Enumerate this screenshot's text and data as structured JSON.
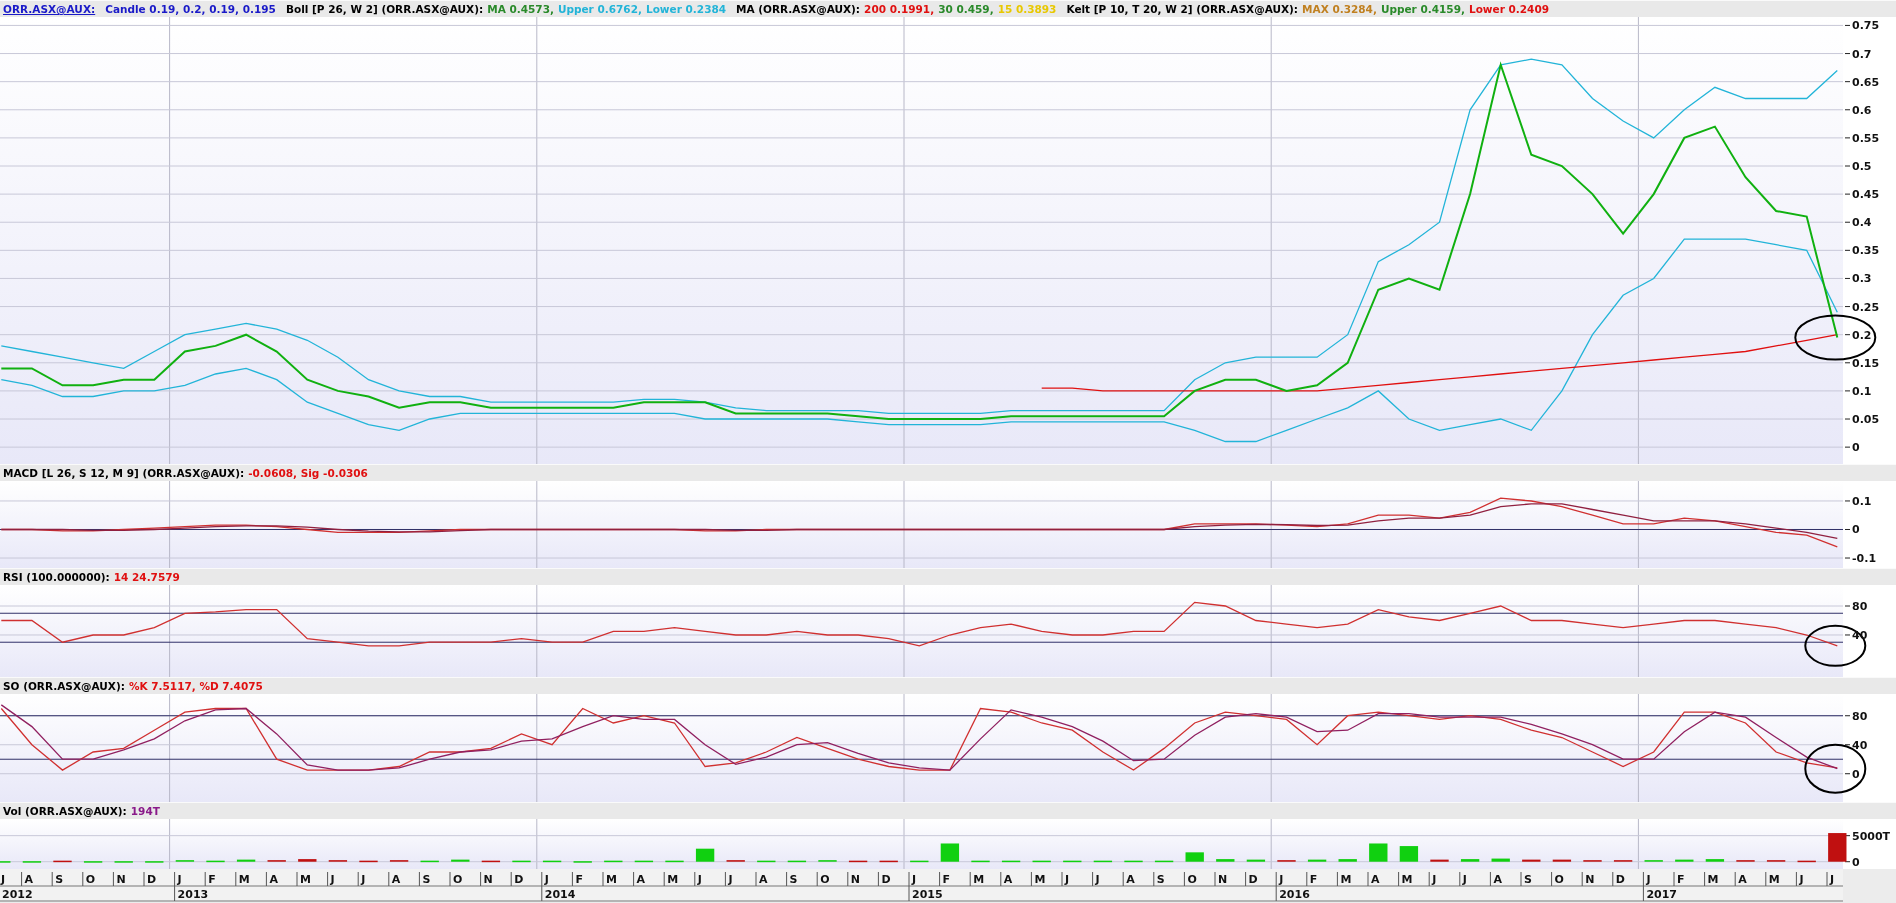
{
  "panels": [
    {
      "kind": "price",
      "legend": [
        {
          "text": "ORR.ASX@AUX:",
          "color": "#1a1ac8",
          "kind": "link"
        },
        {
          "text": "Candle 0.19, 0.2, 0.19, 0.195",
          "color": "#1a1ac8"
        },
        {
          "text": "Boll [P 26, W 2] (ORR.ASX@AUX):",
          "color": "#000000"
        },
        {
          "text": "MA 0.4573,",
          "color": "#2a8a2a"
        },
        {
          "text": "Upper 0.6762,",
          "color": "#22b4d8"
        },
        {
          "text": "Lower 0.2384",
          "color": "#22b4d8"
        },
        {
          "text": "MA (ORR.ASX@AUX):",
          "color": "#000000"
        },
        {
          "text": "200 0.1991,",
          "color": "#e01010"
        },
        {
          "text": "30 0.459,",
          "color": "#2a8a2a"
        },
        {
          "text": "15 0.3893",
          "color": "#e8c800"
        },
        {
          "text": "Kelt [P 10, T 20, W 2] (ORR.ASX@AUX):",
          "color": "#000000"
        },
        {
          "text": "MAX 0.3284,",
          "color": "#c08020"
        },
        {
          "text": "Upper 0.4159,",
          "color": "#2a8a2a"
        },
        {
          "text": "Lower 0.2409",
          "color": "#e01010"
        }
      ],
      "chart_data": {
        "type": "line",
        "ylim": [
          -0.03,
          0.765
        ],
        "yticks": [
          0,
          0.05,
          0.1,
          0.15,
          0.2,
          0.25,
          0.3,
          0.35,
          0.4,
          0.45,
          0.5,
          0.55,
          0.6,
          0.65,
          0.7,
          0.75
        ],
        "series": [
          {
            "color": "#22b4d8",
            "values": [
              0.18,
              0.17,
              0.16,
              0.15,
              0.14,
              0.17,
              0.2,
              0.21,
              0.22,
              0.21,
              0.19,
              0.16,
              0.12,
              0.1,
              0.09,
              0.09,
              0.08,
              0.08,
              0.08,
              0.08,
              0.08,
              0.085,
              0.085,
              0.08,
              0.07,
              0.065,
              0.065,
              0.065,
              0.065,
              0.06,
              0.06,
              0.06,
              0.06,
              0.065,
              0.065,
              0.065,
              0.065,
              0.065,
              0.065,
              0.12,
              0.15,
              0.16,
              0.16,
              0.16,
              0.2,
              0.33,
              0.36,
              0.4,
              0.6,
              0.68,
              0.69,
              0.68,
              0.62,
              0.58,
              0.55,
              0.6,
              0.64,
              0.62,
              0.62,
              0.62,
              0.67
            ]
          },
          {
            "color": "#22b4d8",
            "values": [
              0.12,
              0.11,
              0.09,
              0.09,
              0.1,
              0.1,
              0.11,
              0.13,
              0.14,
              0.12,
              0.08,
              0.06,
              0.04,
              0.03,
              0.05,
              0.06,
              0.06,
              0.06,
              0.06,
              0.06,
              0.06,
              0.06,
              0.06,
              0.05,
              0.05,
              0.05,
              0.05,
              0.05,
              0.045,
              0.04,
              0.04,
              0.04,
              0.04,
              0.045,
              0.045,
              0.045,
              0.045,
              0.045,
              0.045,
              0.03,
              0.01,
              0.01,
              0.03,
              0.05,
              0.07,
              0.1,
              0.05,
              0.03,
              0.04,
              0.05,
              0.03,
              0.1,
              0.2,
              0.27,
              0.3,
              0.37,
              0.37,
              0.37,
              0.36,
              0.35,
              0.24
            ]
          },
          {
            "color": "#e01010",
            "values": [
              null,
              null,
              null,
              null,
              null,
              null,
              null,
              null,
              null,
              null,
              null,
              null,
              null,
              null,
              null,
              null,
              null,
              null,
              null,
              null,
              null,
              null,
              null,
              null,
              null,
              null,
              null,
              null,
              null,
              null,
              null,
              null,
              null,
              null,
              0.105,
              0.105,
              0.1,
              0.1,
              0.1,
              0.1,
              0.1,
              0.1,
              0.1,
              0.1,
              0.105,
              0.11,
              0.115,
              0.12,
              0.125,
              0.13,
              0.135,
              0.14,
              0.145,
              0.15,
              0.155,
              0.16,
              0.165,
              0.17,
              0.18,
              0.19,
              0.2
            ]
          },
          {
            "color": "#10b010",
            "values": [
              0.14,
              0.14,
              0.11,
              0.11,
              0.12,
              0.12,
              0.17,
              0.18,
              0.2,
              0.17,
              0.12,
              0.1,
              0.09,
              0.07,
              0.08,
              0.08,
              0.07,
              0.07,
              0.07,
              0.07,
              0.07,
              0.08,
              0.08,
              0.08,
              0.06,
              0.06,
              0.06,
              0.06,
              0.055,
              0.05,
              0.05,
              0.05,
              0.05,
              0.055,
              0.055,
              0.055,
              0.055,
              0.055,
              0.055,
              0.1,
              0.12,
              0.12,
              0.1,
              0.11,
              0.15,
              0.28,
              0.3,
              0.28,
              0.45,
              0.68,
              0.52,
              0.5,
              0.45,
              0.38,
              0.45,
              0.55,
              0.57,
              0.48,
              0.42,
              0.41,
              0.195
            ]
          }
        ],
        "grid": true
      },
      "highlight_last": true
    },
    {
      "kind": "macd",
      "legend": [
        {
          "text": "MACD [L 26, S 12, M 9] (ORR.ASX@AUX):",
          "color": "#000000"
        },
        {
          "text": "-0.0608, Sig -0.0306",
          "color": "#e01010"
        }
      ],
      "chart_data": {
        "type": "line",
        "ylim": [
          -0.135,
          0.17
        ],
        "yticks": [
          -0.1,
          0,
          0.1
        ],
        "series": [
          {
            "color": "#d03030",
            "values": [
              0,
              0,
              -0.005,
              -0.005,
              0,
              0.005,
              0.01,
              0.015,
              0.015,
              0.01,
              0,
              -0.01,
              -0.01,
              -0.01,
              -0.005,
              0,
              0,
              0,
              0,
              0,
              0,
              0,
              0,
              -0.005,
              -0.005,
              0,
              0,
              0,
              0,
              0,
              0,
              0,
              0,
              0,
              0,
              0,
              0,
              0,
              0,
              0.02,
              0.02,
              0.02,
              0.015,
              0.01,
              0.02,
              0.05,
              0.05,
              0.04,
              0.06,
              0.11,
              0.1,
              0.08,
              0.05,
              0.02,
              0.02,
              0.04,
              0.03,
              0.01,
              -0.01,
              -0.02,
              -0.061
            ]
          },
          {
            "color": "#902040",
            "values": [
              0,
              0,
              0,
              -0.003,
              -0.003,
              0,
              0.005,
              0.01,
              0.013,
              0.013,
              0.008,
              0,
              -0.006,
              -0.008,
              -0.008,
              -0.004,
              0,
              0,
              0,
              0,
              0,
              0,
              0,
              0,
              -0.003,
              -0.003,
              0,
              0,
              0,
              0,
              0,
              0,
              0,
              0,
              0,
              0,
              0,
              0,
              0,
              0.01,
              0.015,
              0.018,
              0.017,
              0.014,
              0.015,
              0.03,
              0.04,
              0.04,
              0.05,
              0.08,
              0.09,
              0.09,
              0.07,
              0.05,
              0.03,
              0.03,
              0.03,
              0.02,
              0.005,
              -0.01,
              -0.031
            ]
          }
        ],
        "grid": true,
        "ref_lines": [
          {
            "axis": "y",
            "value": 0
          }
        ]
      }
    },
    {
      "kind": "rsi",
      "legend": [
        {
          "text": "RSI (100.000000):",
          "color": "#000000"
        },
        {
          "text": "14 24.7579",
          "color": "#e01010"
        }
      ],
      "chart_data": {
        "type": "line",
        "ylim": [
          -18,
          109
        ],
        "yticks": [
          40,
          80
        ],
        "series": [
          {
            "color": "#d03030",
            "values": [
              60,
              60,
              30,
              40,
              40,
              50,
              70,
              72,
              75,
              75,
              35,
              30,
              25,
              25,
              30,
              30,
              30,
              35,
              30,
              30,
              45,
              45,
              50,
              45,
              40,
              40,
              45,
              40,
              40,
              35,
              25,
              40,
              50,
              55,
              45,
              40,
              40,
              45,
              45,
              85,
              80,
              60,
              55,
              50,
              55,
              75,
              65,
              60,
              70,
              80,
              60,
              60,
              55,
              50,
              55,
              60,
              60,
              55,
              50,
              40,
              25
            ]
          }
        ],
        "grid": true,
        "ref_lines": [
          {
            "axis": "y",
            "value": 70
          },
          {
            "axis": "y",
            "value": 30
          }
        ]
      },
      "highlight_last": true
    },
    {
      "kind": "so",
      "legend": [
        {
          "text": "SO (ORR.ASX@AUX):",
          "color": "#000000"
        },
        {
          "text": "%K 7.5117, %D 7.4075",
          "color": "#e01010"
        }
      ],
      "chart_data": {
        "type": "line",
        "ylim": [
          -39,
          110
        ],
        "yticks": [
          0,
          40,
          80
        ],
        "series": [
          {
            "color": "#d03030",
            "values": [
              90,
              40,
              5,
              30,
              35,
              60,
              85,
              90,
              90,
              20,
              5,
              5,
              5,
              10,
              30,
              30,
              35,
              55,
              40,
              90,
              70,
              80,
              70,
              10,
              15,
              30,
              50,
              35,
              20,
              10,
              5,
              5,
              90,
              85,
              70,
              60,
              30,
              5,
              35,
              70,
              85,
              80,
              75,
              40,
              80,
              85,
              80,
              75,
              80,
              75,
              60,
              50,
              30,
              10,
              30,
              85,
              85,
              70,
              30,
              15,
              8
            ]
          },
          {
            "color": "#902060",
            "values": [
              95,
              65,
              20,
              20,
              33,
              48,
              73,
              88,
              90,
              55,
              12,
              5,
              5,
              8,
              20,
              30,
              33,
              45,
              48,
              65,
              80,
              75,
              75,
              40,
              13,
              23,
              40,
              43,
              28,
              15,
              8,
              5,
              48,
              88,
              78,
              65,
              45,
              18,
              20,
              53,
              78,
              83,
              78,
              58,
              60,
              83,
              83,
              78,
              78,
              78,
              68,
              55,
              40,
              20,
              20,
              58,
              85,
              78,
              50,
              23,
              7
            ]
          }
        ],
        "grid": true,
        "ref_lines": [
          {
            "axis": "y",
            "value": 80
          },
          {
            "axis": "y",
            "value": 20
          }
        ]
      },
      "highlight_last": true
    },
    {
      "kind": "volume",
      "legend": [
        {
          "text": "Vol (ORR.ASX@AUX):",
          "color": "#000000"
        },
        {
          "text": "194T",
          "color": "#8a1a8a"
        }
      ],
      "chart_data": {
        "type": "bar",
        "ylim": [
          -1400,
          8200
        ],
        "yticks": [
          0,
          {
            "value": 5000,
            "label": "5000T"
          }
        ],
        "series": [
          {
            "color": "#10d010",
            "values": [
              100,
              100,
              null,
              100,
              100,
              100,
              300,
              200,
              400,
              null,
              null,
              null,
              null,
              null,
              200,
              400,
              null,
              200,
              200,
              100,
              200,
              200,
              200,
              2500,
              null,
              200,
              200,
              300,
              null,
              null,
              200,
              3500,
              200,
              200,
              200,
              200,
              200,
              200,
              200,
              1800,
              500,
              400,
              null,
              400,
              500,
              3500,
              3000,
              null,
              500,
              600,
              null,
              null,
              null,
              null,
              300,
              400,
              500,
              null,
              null,
              null,
              null
            ]
          },
          {
            "color": "#c01010",
            "values": [
              null,
              null,
              200,
              null,
              null,
              null,
              null,
              null,
              null,
              300,
              500,
              300,
              200,
              300,
              null,
              null,
              200,
              null,
              null,
              null,
              null,
              null,
              null,
              null,
              300,
              null,
              null,
              null,
              200,
              200,
              null,
              null,
              null,
              null,
              null,
              null,
              null,
              null,
              null,
              null,
              null,
              null,
              300,
              null,
              null,
              null,
              null,
              400,
              null,
              null,
              400,
              400,
              300,
              300,
              null,
              null,
              null,
              300,
              300,
              200,
              5500
            ]
          }
        ],
        "grid": true
      }
    }
  ],
  "xaxis": {
    "months": [
      "J",
      "A",
      "S",
      "O",
      "N",
      "D",
      "J",
      "F",
      "M",
      "A",
      "M",
      "J",
      "J",
      "A",
      "S",
      "O",
      "N",
      "D",
      "J",
      "F",
      "M",
      "A",
      "M",
      "J",
      "J",
      "A",
      "S",
      "O",
      "N",
      "D",
      "J",
      "F",
      "M",
      "A",
      "M",
      "J",
      "J",
      "A",
      "S",
      "O",
      "N",
      "D",
      "J",
      "F",
      "M",
      "A",
      "M",
      "J",
      "J",
      "A",
      "S",
      "O",
      "N",
      "D",
      "J",
      "F",
      "M",
      "A",
      "M",
      "J",
      "J"
    ],
    "years": [
      "2012",
      "2013",
      "2014",
      "2015",
      "2016",
      "2017"
    ]
  }
}
